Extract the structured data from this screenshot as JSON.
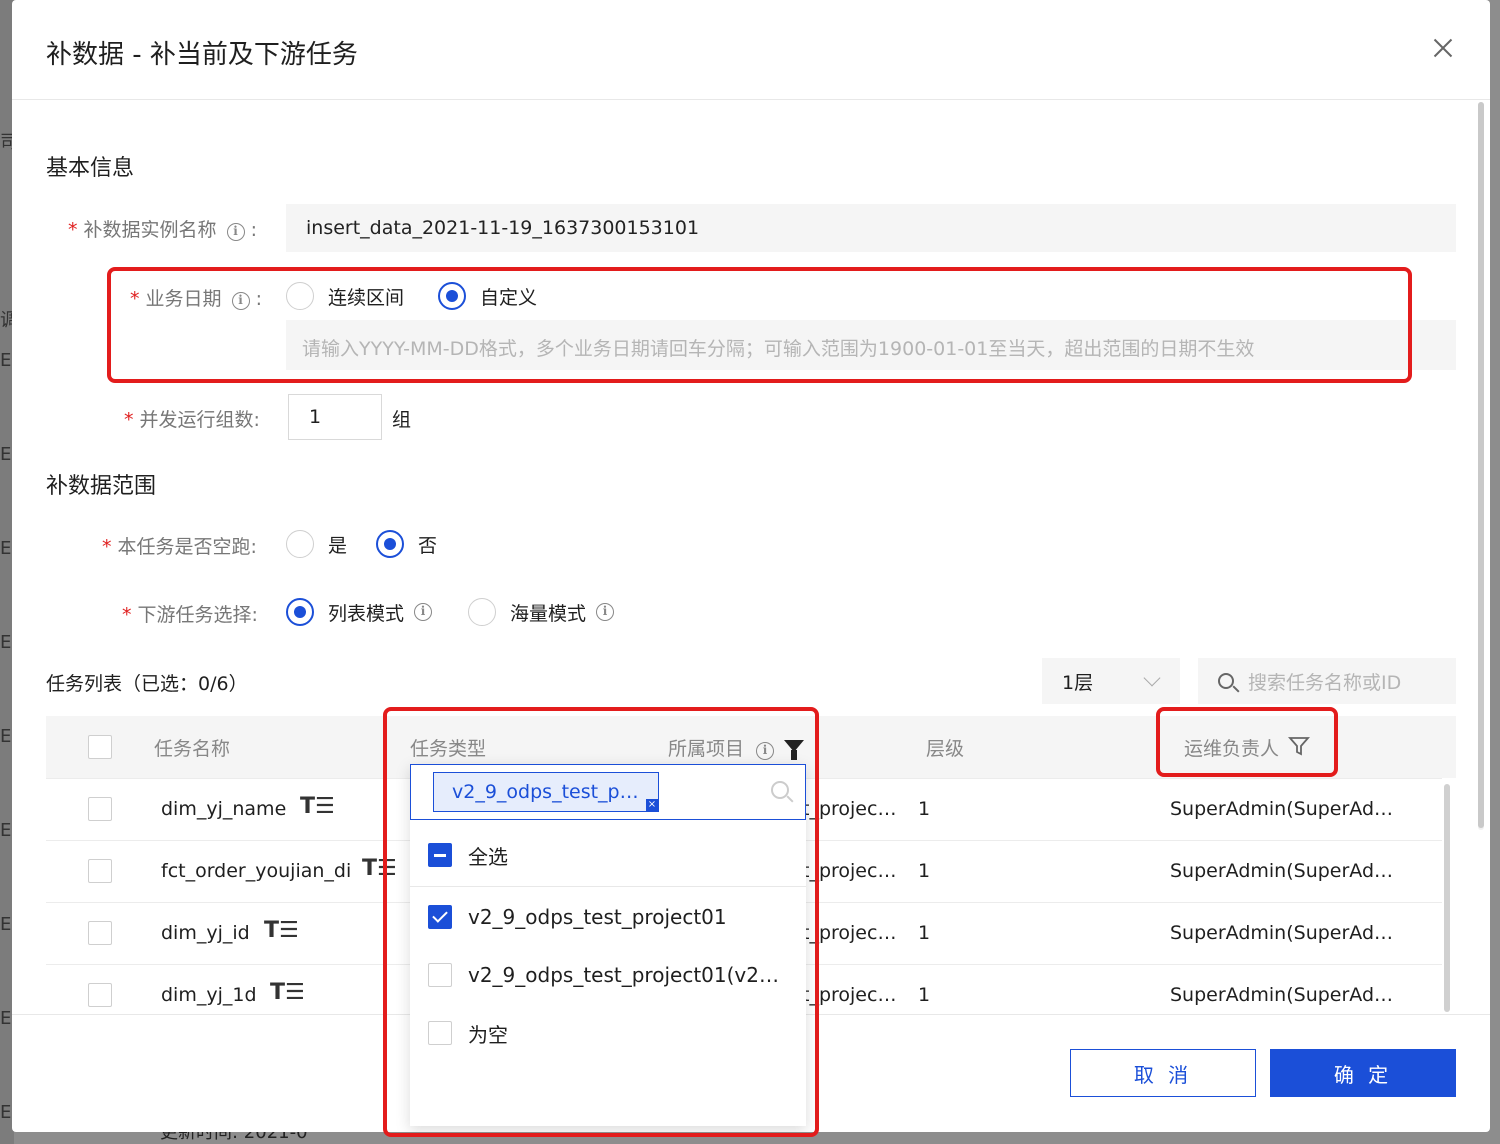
{
  "background": {
    "side_chars": [
      "司",
      "调",
      "E",
      "E",
      "E",
      "E",
      "E",
      "E",
      "E",
      "E",
      "E"
    ],
    "bottom_text": "更新时间:    2021-0"
  },
  "modal": {
    "title": "补数据 - 补当前及下游任务",
    "close_icon": "close-icon"
  },
  "basic_info": {
    "section_title": "基本信息",
    "instance_name": {
      "label": "补数据实例名称",
      "colon": ":",
      "value": "insert_data_2021-11-19_1637300153101"
    },
    "biz_date": {
      "label": "业务日期",
      "colon": ":",
      "options": [
        "连续区间",
        "自定义"
      ],
      "selected": "自定义",
      "placeholder": "请输入YYYY-MM-DD格式，多个业务日期请回车分隔；可输入范围为1900-01-01至当天，超出范围的日期不生效"
    },
    "concurrency": {
      "label": "并发运行组数:",
      "value": "1",
      "unit": "组"
    }
  },
  "scope": {
    "section_title": "补数据范围",
    "dry_run": {
      "label": "本任务是否空跑:",
      "options": [
        "是",
        "否"
      ],
      "selected": "否"
    },
    "downstream": {
      "label": "下游任务选择:",
      "options": [
        "列表模式",
        "海量模式"
      ],
      "selected": "列表模式"
    }
  },
  "task_list": {
    "title": "任务列表（已选：0/6）",
    "level_select": "1层",
    "search_placeholder": "搜索任务名称或ID",
    "columns": [
      "任务名称",
      "任务类型",
      "所属项目",
      "层级",
      "运维负责人"
    ],
    "rows": [
      {
        "name": "dim_yj_name",
        "project": "t_projec…",
        "level": "1",
        "owner": "SuperAdmin(SuperAd…"
      },
      {
        "name": "fct_order_youjian_di",
        "project": "t_projec…",
        "level": "1",
        "owner": "SuperAdmin(SuperAd…"
      },
      {
        "name": "dim_yj_id",
        "project": "t_projec…",
        "level": "1",
        "owner": "SuperAdmin(SuperAd…"
      },
      {
        "name": "dim_yj_1d",
        "project": "t_projec…",
        "level": "1",
        "owner": "SuperAdmin(SuperAd…"
      }
    ]
  },
  "project_filter": {
    "tag": "v2_9_odps_test_p…",
    "tag_close": "×",
    "items": [
      {
        "label": "全选",
        "state": "partial"
      },
      {
        "label": "v2_9_odps_test_project01",
        "state": "checked"
      },
      {
        "label": "v2_9_odps_test_project01(v2…",
        "state": "unchecked"
      },
      {
        "label": "为空",
        "state": "unchecked"
      }
    ]
  },
  "footer": {
    "cancel": "取 消",
    "ok": "确 定"
  },
  "colors": {
    "accent": "#1b4fd8",
    "highlight_box": "#e31c1c",
    "required_star": "#e02020"
  }
}
